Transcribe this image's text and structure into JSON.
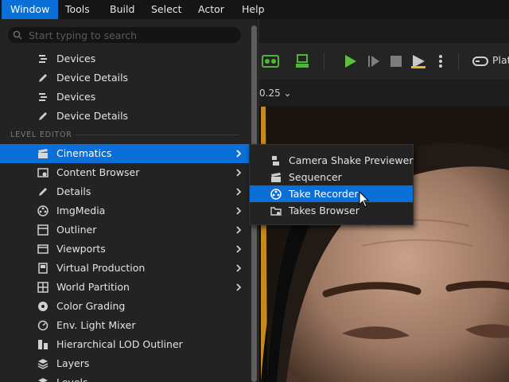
{
  "menubar": {
    "items": [
      {
        "label": "Window",
        "active": true
      },
      {
        "label": "Tools"
      },
      {
        "label": "Build"
      },
      {
        "label": "Select"
      },
      {
        "label": "Actor"
      },
      {
        "label": "Help"
      }
    ]
  },
  "search": {
    "placeholder": "Start typing to search",
    "value": ""
  },
  "top_items": [
    {
      "label": "Devices",
      "icon": "devices-icon"
    },
    {
      "label": "Device Details",
      "icon": "pencil-icon"
    },
    {
      "label": "Devices",
      "icon": "devices-icon"
    },
    {
      "label": "Device Details",
      "icon": "pencil-icon"
    }
  ],
  "section_label": "LEVEL EDITOR",
  "level_editor_items": [
    {
      "label": "Cinematics",
      "icon": "clapperboard-icon",
      "submenu": true,
      "highlight": true
    },
    {
      "label": "Content Browser",
      "icon": "content-browser-icon",
      "submenu": true
    },
    {
      "label": "Details",
      "icon": "pencil-icon",
      "submenu": true
    },
    {
      "label": "ImgMedia",
      "icon": "film-reel-icon",
      "submenu": true
    },
    {
      "label": "Outliner",
      "icon": "outliner-icon",
      "submenu": true
    },
    {
      "label": "Viewports",
      "icon": "viewports-icon",
      "submenu": true
    },
    {
      "label": "Virtual Production",
      "icon": "virtual-production-icon",
      "submenu": true
    },
    {
      "label": "World Partition",
      "icon": "world-partition-icon",
      "submenu": true
    },
    {
      "label": "Color Grading",
      "icon": "color-grading-icon"
    },
    {
      "label": "Env. Light Mixer",
      "icon": "light-mixer-icon"
    },
    {
      "label": "Hierarchical LOD Outliner",
      "icon": "lod-outliner-icon"
    },
    {
      "label": "Layers",
      "icon": "layers-icon"
    },
    {
      "label": "Levels",
      "icon": "levels-icon"
    }
  ],
  "submenu": {
    "items": [
      {
        "label": "Camera Shake Previewer",
        "icon": "camera-shake-icon"
      },
      {
        "label": "Sequencer",
        "icon": "clapperboard-icon"
      },
      {
        "label": "Take Recorder",
        "icon": "film-reel-icon",
        "highlight": true
      },
      {
        "label": "Takes Browser",
        "icon": "folder-icon"
      }
    ]
  },
  "toolbar": {
    "zoom": "0.25",
    "platforms_label": "Plat"
  },
  "colors": {
    "accent": "#0a6fd6",
    "menu_bg": "#232323",
    "play_green": "#5fbf3c"
  }
}
